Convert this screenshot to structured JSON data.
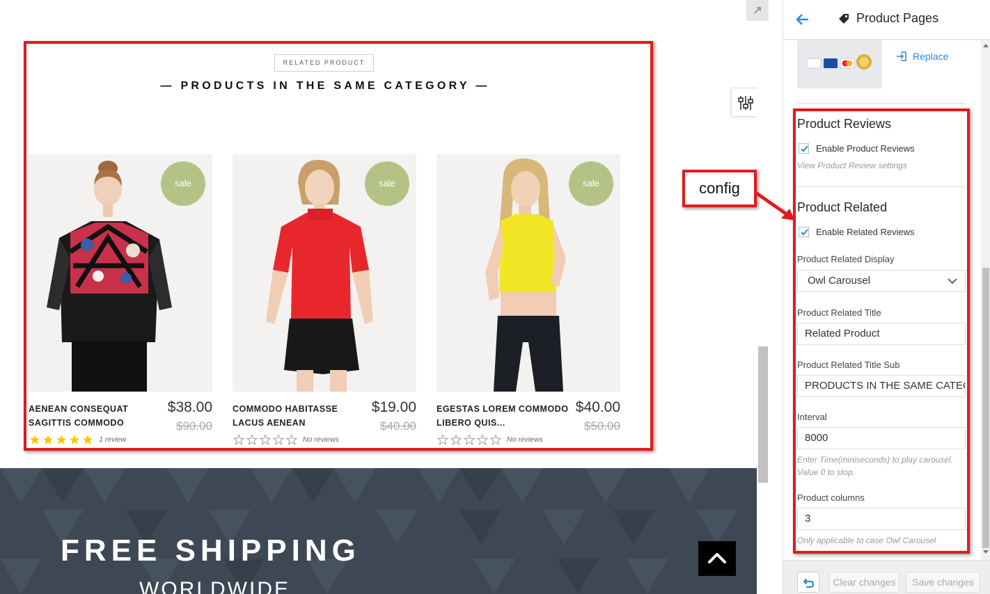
{
  "colors": {
    "accent_red": "#e11b1b",
    "sale_badge": "#b5c285",
    "link_blue": "#2e89d6",
    "footer_bg": "#3d4854"
  },
  "preview": {
    "collapse_icon": "arrow-expand-icon",
    "related_label": "RELATED PRODUCT",
    "related_heading": "— PRODUCTS IN THE SAME CATEGORY —",
    "products": [
      {
        "name": "AENEAN CONSEQUAT SAGITTIS COMMODO",
        "price": "$38.00",
        "old_price": "$90.00",
        "badge": "sale",
        "rating": 5,
        "rating_text": "1 review"
      },
      {
        "name": "COMMODO HABITASSE LACUS AENEAN",
        "price": "$19.00",
        "old_price": "$40.00",
        "badge": "sale",
        "rating": 0,
        "rating_text": "No reviews"
      },
      {
        "name": "EGESTAS LOREM COMMODO LIBERO QUIS...",
        "price": "$40.00",
        "old_price": "$50.00",
        "badge": "sale",
        "rating": 0,
        "rating_text": "No reviews"
      }
    ],
    "callout": "config",
    "footer": {
      "title": "FREE SHIPPING",
      "subtitle": "WORLDWIDE"
    }
  },
  "panel": {
    "title": "Product Pages",
    "replace_label": "Replace",
    "reviews": {
      "title": "Product Reviews",
      "checkbox_label": "Enable Product Reviews",
      "checked": true,
      "link": "View Product Review settings"
    },
    "related": {
      "title": "Product Related",
      "checkbox_label": "Enable Related Reviews",
      "checked": true,
      "display_label": "Product Related Display",
      "display_value": "Owl Carousel",
      "title_label": "Product Related Title",
      "title_value": "Related Product",
      "sub_label": "Product Related Title Sub",
      "sub_value": "PRODUCTS IN THE SAME CATEGORY",
      "interval_label": "Interval",
      "interval_value": "8000",
      "interval_hint": "Enter Time(miniseconds) to play carousel. Value 0 to stop.",
      "columns_label": "Product columns",
      "columns_value": "3",
      "columns_hint": "Only applicable to case Owl Carousel"
    },
    "footer": {
      "clear_label": "Clear changes",
      "save_label": "Save changes"
    }
  }
}
